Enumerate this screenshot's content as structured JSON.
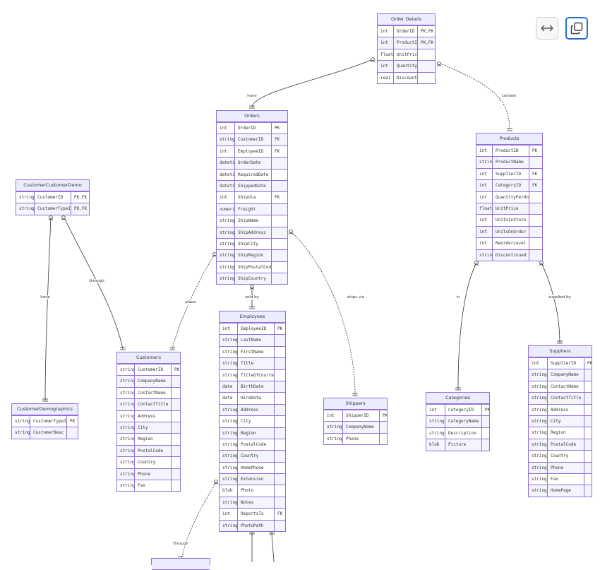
{
  "diagram": {
    "entities": [
      {
        "id": "order_details",
        "title": "Order Details",
        "rows": [
          [
            "int",
            "OrderID",
            "PK,FK"
          ],
          [
            "int",
            "ProductID",
            "PK,FK"
          ],
          [
            "float",
            "UnitPrice",
            ""
          ],
          [
            "int",
            "Quantity",
            ""
          ],
          [
            "real",
            "Discount",
            ""
          ]
        ]
      },
      {
        "id": "orders",
        "title": "Orders",
        "rows": [
          [
            "int",
            "OrderID",
            "PK"
          ],
          [
            "string",
            "CustomerID",
            "FK"
          ],
          [
            "int",
            "EmployeeID",
            "FK"
          ],
          [
            "datetime",
            "OrderDate",
            ""
          ],
          [
            "datetime",
            "RequiredDate",
            ""
          ],
          [
            "datetime",
            "ShippedDate",
            ""
          ],
          [
            "int",
            "ShipVia",
            "FK"
          ],
          [
            "numeric",
            "Freight",
            ""
          ],
          [
            "string",
            "ShipName",
            ""
          ],
          [
            "string",
            "ShipAddress",
            ""
          ],
          [
            "string",
            "ShipCity",
            ""
          ],
          [
            "string",
            "ShipRegion",
            ""
          ],
          [
            "string",
            "ShipPostalCode",
            ""
          ],
          [
            "string",
            "ShipCountry",
            ""
          ]
        ]
      },
      {
        "id": "products",
        "title": "Products",
        "rows": [
          [
            "int",
            "ProductID",
            "PK"
          ],
          [
            "string",
            "ProductName",
            ""
          ],
          [
            "int",
            "SupplierID",
            "FK"
          ],
          [
            "int",
            "CategoryID",
            "FK"
          ],
          [
            "int",
            "QuantityPerUnit",
            ""
          ],
          [
            "float",
            "UnitPrice",
            ""
          ],
          [
            "int",
            "UnitsInStock",
            ""
          ],
          [
            "int",
            "UnitsOnOrder",
            ""
          ],
          [
            "int",
            "ReorderLevel",
            ""
          ],
          [
            "string",
            "Discontinued",
            ""
          ]
        ]
      },
      {
        "id": "ccd",
        "title": "CustomerCustomerDemo",
        "rows": [
          [
            "string",
            "CustomerID",
            "PK,FK"
          ],
          [
            "string",
            "CustomerTypeID",
            "PK,FK"
          ]
        ]
      },
      {
        "id": "cdemo",
        "title": "CustomerDemographics",
        "rows": [
          [
            "string",
            "CustomerTypeID",
            "PK"
          ],
          [
            "string",
            "CustomerDesc",
            ""
          ]
        ]
      },
      {
        "id": "customers",
        "title": "Customers",
        "rows": [
          [
            "string",
            "CustomerID",
            "PK"
          ],
          [
            "string",
            "CompanyName",
            ""
          ],
          [
            "string",
            "ContactName",
            ""
          ],
          [
            "string",
            "ContactTitle",
            ""
          ],
          [
            "string",
            "Address",
            ""
          ],
          [
            "string",
            "City",
            ""
          ],
          [
            "string",
            "Region",
            ""
          ],
          [
            "string",
            "PostalCode",
            ""
          ],
          [
            "string",
            "Country",
            ""
          ],
          [
            "string",
            "Phone",
            ""
          ],
          [
            "string",
            "Fax",
            ""
          ]
        ]
      },
      {
        "id": "employees",
        "title": "Employees",
        "rows": [
          [
            "int",
            "EmployeeID",
            "PK"
          ],
          [
            "string",
            "LastName",
            ""
          ],
          [
            "string",
            "FirstName",
            ""
          ],
          [
            "string",
            "Title",
            ""
          ],
          [
            "string",
            "TitleOfCourtesy",
            ""
          ],
          [
            "date",
            "BirthDate",
            ""
          ],
          [
            "date",
            "HireDate",
            ""
          ],
          [
            "string",
            "Address",
            ""
          ],
          [
            "string",
            "City",
            ""
          ],
          [
            "string",
            "Region",
            ""
          ],
          [
            "string",
            "PostalCode",
            ""
          ],
          [
            "string",
            "Country",
            ""
          ],
          [
            "string",
            "HomePhone",
            ""
          ],
          [
            "string",
            "Extension",
            ""
          ],
          [
            "blob",
            "Photo",
            ""
          ],
          [
            "string",
            "Notes",
            ""
          ],
          [
            "int",
            "ReportsTo",
            "FK"
          ],
          [
            "string",
            "PhotoPath",
            ""
          ]
        ]
      },
      {
        "id": "shippers",
        "title": "Shippers",
        "rows": [
          [
            "int",
            "ShipperID",
            "PK"
          ],
          [
            "string",
            "CompanyName",
            ""
          ],
          [
            "string",
            "Phone",
            ""
          ]
        ]
      },
      {
        "id": "categories",
        "title": "Categories",
        "rows": [
          [
            "int",
            "CategoryID",
            "PK"
          ],
          [
            "string",
            "CategoryName",
            ""
          ],
          [
            "string",
            "Description",
            ""
          ],
          [
            "blob",
            "Picture",
            ""
          ]
        ]
      },
      {
        "id": "suppliers",
        "title": "Suppliers",
        "rows": [
          [
            "int",
            "SupplierID",
            "PK"
          ],
          [
            "string",
            "CompanyName",
            ""
          ],
          [
            "string",
            "ContactName",
            ""
          ],
          [
            "string",
            "ContactTitle",
            ""
          ],
          [
            "string",
            "Address",
            ""
          ],
          [
            "string",
            "City",
            ""
          ],
          [
            "string",
            "Region",
            ""
          ],
          [
            "string",
            "PostalCode",
            ""
          ],
          [
            "string",
            "Country",
            ""
          ],
          [
            "string",
            "Phone",
            ""
          ],
          [
            "string",
            "Fax",
            ""
          ],
          [
            "string",
            "HomePage",
            ""
          ]
        ]
      },
      {
        "id": "bottom",
        "title": "",
        "rows": []
      }
    ],
    "relationships": [
      {
        "id": "orders-orderdetails",
        "label": "have"
      },
      {
        "id": "products-orderdetails",
        "label": "contain"
      },
      {
        "id": "cdemo-ccd",
        "label": "have"
      },
      {
        "id": "customers-ccd",
        "label": "through"
      },
      {
        "id": "customers-orders",
        "label": "place"
      },
      {
        "id": "employees-orders",
        "label": "sold by"
      },
      {
        "id": "shippers-orders",
        "label": "ships via"
      },
      {
        "id": "categories-products",
        "label": "in"
      },
      {
        "id": "suppliers-products",
        "label": "supplied by"
      },
      {
        "id": "employees-territories",
        "label": "through"
      }
    ]
  },
  "toolbar": {
    "expand_icon": "expand-horizontal-icon",
    "copy_icon": "copy-icon"
  },
  "colors": {
    "entity_fill": "#ECECFF",
    "entity_border": "#9370DB",
    "row_alt": "#F4F4FF",
    "edge": "#333333",
    "accent": "#1f6fd1"
  }
}
